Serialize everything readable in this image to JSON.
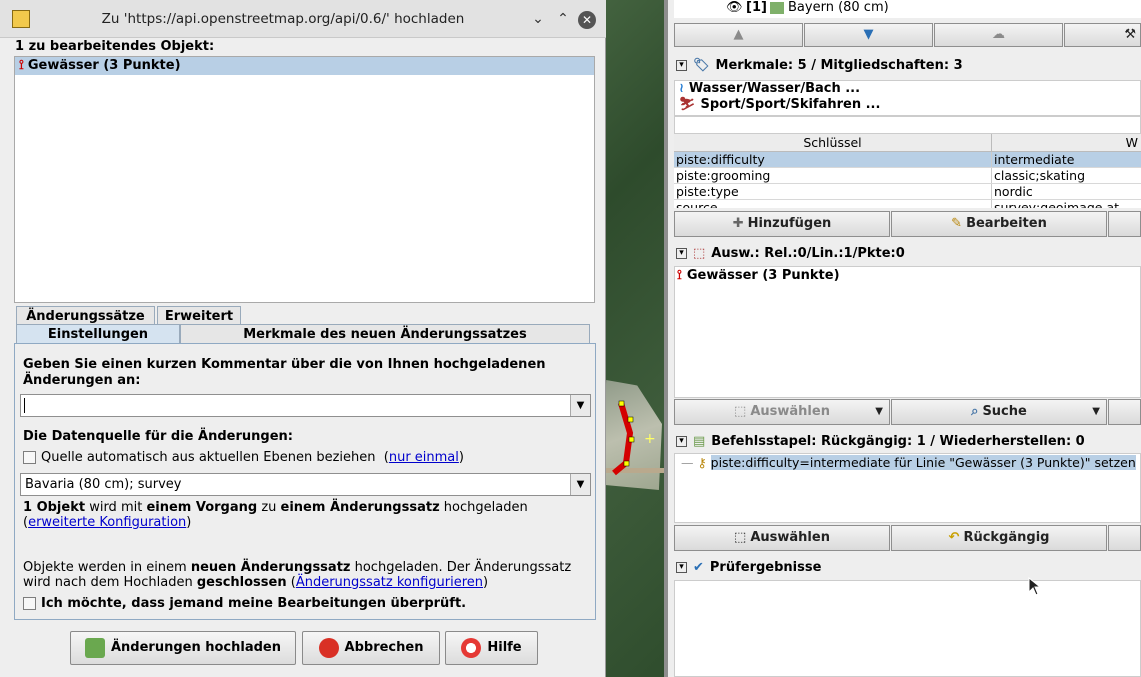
{
  "dialog": {
    "title": "Zu 'https://api.openstreetmap.org/api/0.6/' hochladen",
    "objects_heading": "1 zu bearbeitendes Objekt:",
    "objects": [
      "Gewässer (3 Punkte)"
    ],
    "tabs_row1": [
      "Änderungssätze",
      "Erweitert"
    ],
    "tabs_row2": [
      "Einstellungen",
      "Merkmale des neuen Änderungssatzes"
    ],
    "comment_prompt": "Geben Sie einen kurzen Kommentar über die von Ihnen hochgeladenen Änderungen an:",
    "comment_value": "",
    "source_heading": "Die Datenquelle für die Änderungen:",
    "auto_source_label": "Quelle automatisch aus aktuellen Ebenen beziehen",
    "auto_source_link": "nur einmal",
    "source_value": "Bavaria (80 cm); survey",
    "upload_info": {
      "part1": "1 Objekt",
      "part2": " wird mit ",
      "part3": "einem Vorgang",
      "part4": " zu ",
      "part5": "einem Änderungssatz",
      "part6": " hochgeladen (",
      "link": "erweiterte Konfiguration",
      "part7": ")"
    },
    "changeset_info": {
      "part1": "Objekte werden in einem ",
      "part2": "neuen Änderungssatz",
      "part3": " hochgeladen. Der Änderungssatz wird nach dem Hochladen ",
      "part4": "geschlossen",
      "part5": " (",
      "link": "Änderungssatz konfigurieren",
      "part6": ")"
    },
    "review_label": "Ich möchte, dass jemand meine Bearbeitungen überprüft.",
    "buttons": {
      "upload": "Änderungen hochladen",
      "cancel": "Abbrechen",
      "help": "Hilfe"
    }
  },
  "right": {
    "layer_item": "[1]",
    "layer_name": "Bayern (80 cm)",
    "tags_header": "Merkmale: 5 / Mitgliedschaften: 3",
    "presets": [
      "Wasser/Wasser/Bach ...",
      "Sport/Sport/Skifahren ..."
    ],
    "table_headers": [
      "Schlüssel",
      "W"
    ],
    "table_rows": [
      {
        "key": "piste:difficulty",
        "value": "intermediate"
      },
      {
        "key": "piste:grooming",
        "value": "classic;skating"
      },
      {
        "key": "piste:type",
        "value": "nordic"
      },
      {
        "key": "source",
        "value": "survey;geoimage.at"
      }
    ],
    "tag_buttons": {
      "add": "Hinzufügen",
      "edit": "Bearbeiten"
    },
    "selection_header": "Ausw.: Rel.:0/Lin.:1/Pkte:0",
    "selection_items": [
      "Gewässer (3 Punkte)"
    ],
    "selection_buttons": {
      "select": "Auswählen",
      "search": "Suche"
    },
    "command_header": "Befehlsstapel: Rückgängig: 1 / Wiederherstellen: 0",
    "command_items": [
      "piste:difficulty=intermediate für Linie \"Gewässer (3 Punkte)\" setzen"
    ],
    "command_buttons": {
      "select": "Auswählen",
      "undo": "Rückgängig"
    },
    "validation_header": "Prüfergebnisse"
  }
}
